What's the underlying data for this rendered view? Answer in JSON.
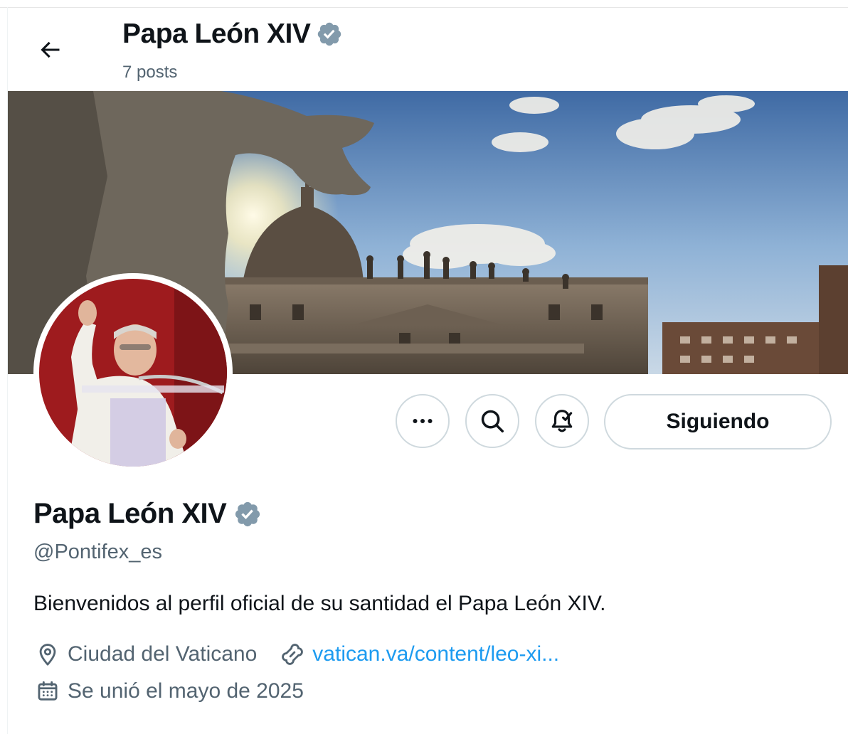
{
  "header": {
    "back_icon": "arrow-left-icon",
    "title": "Papa León XIV",
    "posts_count": "7 posts",
    "verified_icon": "verified-badge-icon"
  },
  "actions": {
    "more_icon": "more-horizontal-icon",
    "search_icon": "search-icon",
    "notifications_icon": "bell-check-icon",
    "follow_label": "Siguiendo"
  },
  "profile": {
    "name": "Papa León XIV",
    "handle": "@Pontifex_es",
    "bio": "Bienvenidos al perfil oficial de su santidad el Papa León XIV.",
    "location": "Ciudad del Vaticano",
    "location_icon": "location-pin-icon",
    "website": "vatican.va/content/leo-xi...",
    "website_icon": "link-icon",
    "joined": "Se unió el mayo de 2025",
    "joined_icon": "calendar-icon"
  },
  "colors": {
    "verified": "#829aab",
    "link": "#1d9bf0",
    "secondary_text": "#536471",
    "border": "#cfd9de"
  }
}
